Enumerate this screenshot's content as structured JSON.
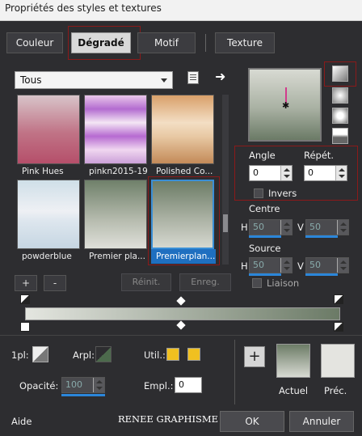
{
  "window": {
    "title": "Propriétés des styles et textures"
  },
  "tabs": [
    {
      "label": "Couleur"
    },
    {
      "label": "Dégradé"
    },
    {
      "label": "Motif"
    },
    {
      "label": "Texture"
    }
  ],
  "filter": {
    "selected": "Tous"
  },
  "gradients": [
    {
      "label": "Pink Hues"
    },
    {
      "label": "pinkn2015-19"
    },
    {
      "label": "Polished Co..."
    },
    {
      "label": "powderblue"
    },
    {
      "label": "Premier pla..."
    },
    {
      "label": "Premierplan..."
    }
  ],
  "list_buttons": {
    "add": "+",
    "remove": "-",
    "reset": "Réinit.",
    "save": "Enreg."
  },
  "params": {
    "angle_label": "Angle",
    "angle_value": "0",
    "repeat_label": "Répét.",
    "repeat_value": "0",
    "invert_label": "Invers",
    "center_label": "Centre",
    "center_h_label": "H",
    "center_h": "50",
    "center_v_label": "V",
    "center_v": "50",
    "source_label": "Source",
    "source_h_label": "H",
    "source_h": "50",
    "source_v_label": "V",
    "source_v": "50",
    "link_label": "Liaison"
  },
  "stops": {
    "pl_label": "1pl:",
    "arpl_label": "Arpl:",
    "util_label": "Util.:",
    "opacity_label": "Opacité:",
    "opacity_value": "100",
    "empl_label": "Empl.:",
    "empl_value": "0"
  },
  "swatches": {
    "current_label": "Actuel",
    "previous_label": "Préc."
  },
  "footer": {
    "help": "Aide",
    "watermark": "RENEE GRAPHISME",
    "ok": "OK",
    "cancel": "Annuler"
  },
  "colors": {
    "gradient_start": "#e4e6e0",
    "gradient_end": "#6b7a66",
    "accent": "#2b86d9",
    "highlight_red": "#8b1a1a",
    "user_yellow": "#f0c020"
  }
}
